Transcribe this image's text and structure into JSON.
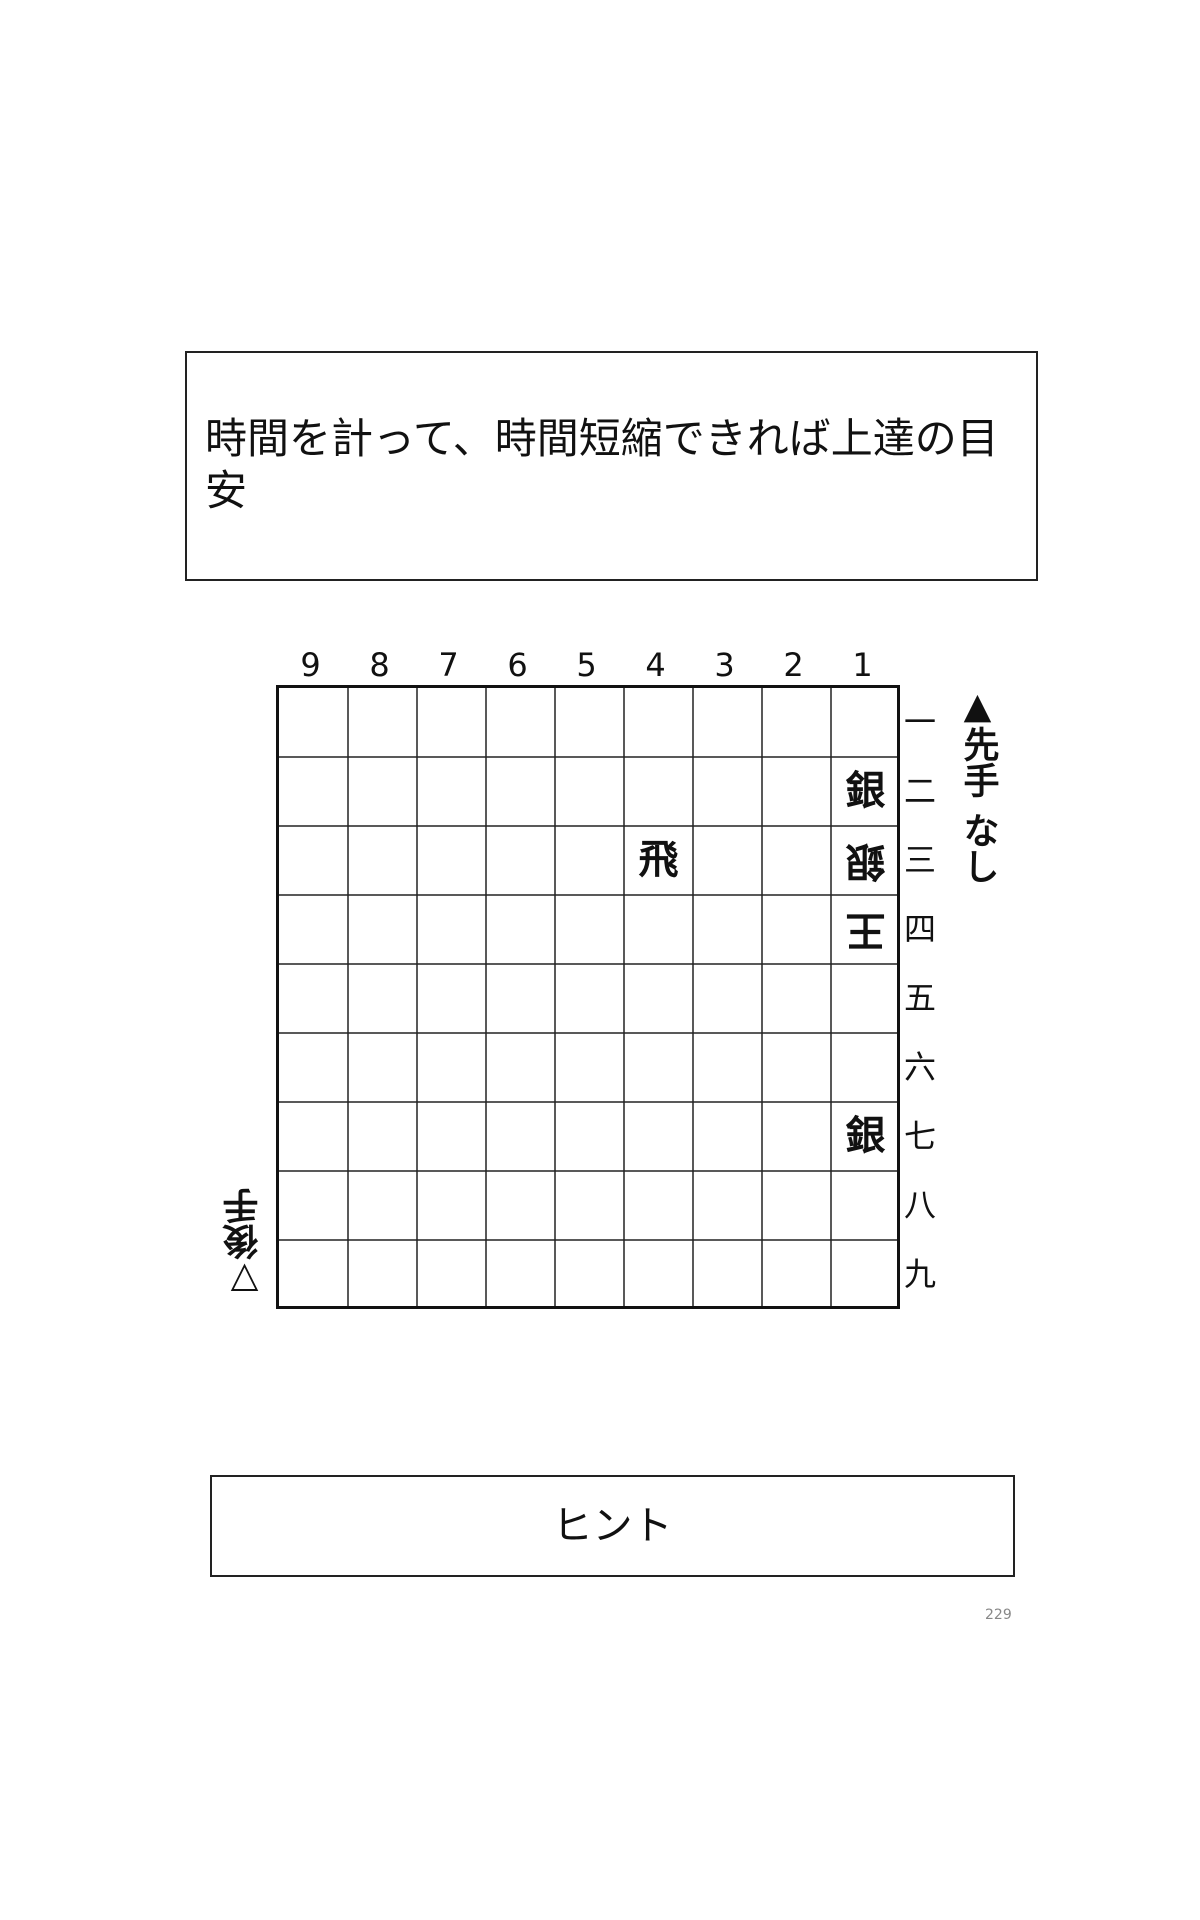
{
  "instruction": {
    "text": "時間を計って、時間短縮できれば上達の目安"
  },
  "board": {
    "file_labels": [
      "9",
      "8",
      "7",
      "6",
      "5",
      "4",
      "3",
      "2",
      "1"
    ],
    "rank_labels": [
      "一",
      "二",
      "三",
      "四",
      "五",
      "六",
      "七",
      "八",
      "九"
    ],
    "pieces": [
      {
        "file": 1,
        "rank": 2,
        "piece": "銀",
        "side": "sente"
      },
      {
        "file": 1,
        "rank": 3,
        "piece": "銀",
        "side": "gote"
      },
      {
        "file": 4,
        "rank": 3,
        "piece": "飛",
        "side": "sente"
      },
      {
        "file": 1,
        "rank": 4,
        "piece": "王",
        "side": "gote"
      },
      {
        "file": 1,
        "rank": 7,
        "piece": "銀",
        "side": "sente"
      }
    ]
  },
  "sente": {
    "mark": "▲",
    "label": "先手",
    "hand": "なし"
  },
  "gote": {
    "mark": "▽",
    "label": "後手"
  },
  "hint": {
    "label": "ヒント"
  },
  "page": {
    "number": "229"
  }
}
